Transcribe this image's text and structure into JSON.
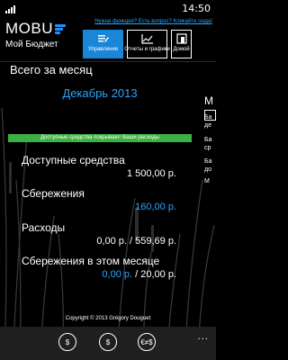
{
  "status": {
    "time": "14:50"
  },
  "header": {
    "app_name": "MOBU",
    "subtitle": "Мой Бюджет",
    "link": "Нужна функция? Есть вопрос? Кликайте сюда!",
    "tabs": [
      {
        "label": "Управление",
        "icon": "edit-list-icon",
        "active": true
      },
      {
        "label": "Отчеты и графики",
        "icon": "chart-icon",
        "active": false
      },
      {
        "label": "Домой",
        "icon": "home-icon",
        "active": false
      }
    ]
  },
  "main": {
    "section_title": "Всего за месяц",
    "month": "Декабрь 2013",
    "status_message": "Доступные средства покрывают Ваши расходы",
    "rows": [
      {
        "label": "Доступные средства",
        "value": "1 500,00 р."
      },
      {
        "label": "Сбережения",
        "value": "160,00 р."
      },
      {
        "label": "Расходы",
        "value": "0,00 р. / 559,69 р."
      },
      {
        "label": "Сбережения в этом месяце",
        "value_part1": "0,00 р.",
        "value_sep": " / ",
        "value_part2": "20,00 р."
      }
    ]
  },
  "peek": {
    "title": "М",
    "lines": [
      "Ба",
      "де",
      "Ба",
      "ср",
      "Ба",
      "до",
      "М"
    ]
  },
  "footer": {
    "copyright": "Copyright © 2013 Grégory Douguet"
  },
  "appbar": {
    "buttons": [
      {
        "icon": "coins-icon",
        "glyph": "$"
      },
      {
        "icon": "money-bag-icon",
        "glyph": "$"
      },
      {
        "icon": "currency-exchange-icon",
        "glyph": "€≠$"
      }
    ],
    "more": "..."
  },
  "colors": {
    "accent": "#1a86d8",
    "link": "#2aa4ff",
    "status_ok": "#3cb043",
    "appbar": "#1f1f1f"
  }
}
